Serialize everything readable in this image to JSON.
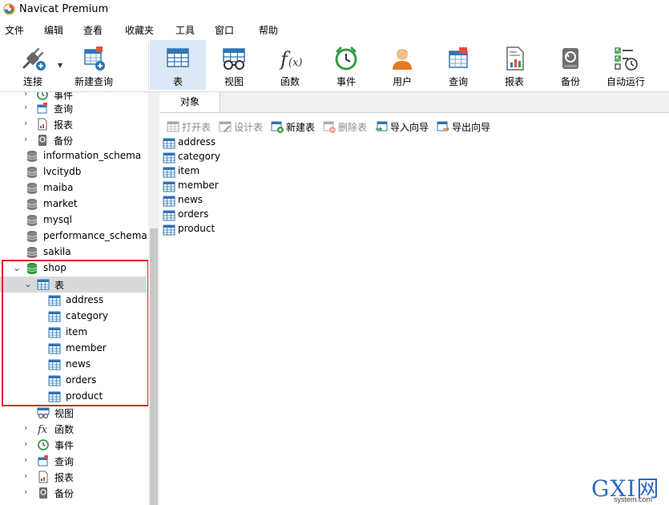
{
  "window": {
    "title": "Navicat Premium"
  },
  "menu": [
    "文件",
    "编辑",
    "查看",
    "收藏夹",
    "工具",
    "窗口",
    "帮助"
  ],
  "toolbar": {
    "connect": "连接",
    "new_query": "新建查询",
    "table": "表",
    "view": "视图",
    "function": "函数",
    "event": "事件",
    "user": "用户",
    "query": "查询",
    "report": "报表",
    "backup": "备份",
    "automation": "自动运行"
  },
  "tree": {
    "top_event": "事件",
    "top_query": "查询",
    "top_report": "报表",
    "top_backup": "备份",
    "databases": [
      "information_schema",
      "lvcitydb",
      "maiba",
      "market",
      "mysql",
      "performance_schema",
      "sakila"
    ],
    "shop": "shop",
    "tables_group": "表",
    "tables": [
      "address",
      "category",
      "item",
      "member",
      "news",
      "orders",
      "product"
    ],
    "views_group": "视图",
    "functions_group": "函数",
    "events_group": "事件",
    "queries_group": "查询",
    "reports_group": "报表",
    "backups_group": "备份"
  },
  "tabs": {
    "objects": "对象"
  },
  "object_toolbar": {
    "open_table": "打开表",
    "design_table": "设计表",
    "new_table": "新建表",
    "delete_table": "删除表",
    "import_wizard": "导入向导",
    "export_wizard": "导出向导"
  },
  "objects": [
    "address",
    "category",
    "item",
    "member",
    "news",
    "orders",
    "product"
  ],
  "watermark": {
    "main": "GXI网",
    "sub": "system.com"
  },
  "colors": {
    "accent": "#2e75b6",
    "highlight": "#e3232a",
    "selected": "#d9d9d9",
    "active_tool": "#dbe8f6"
  }
}
